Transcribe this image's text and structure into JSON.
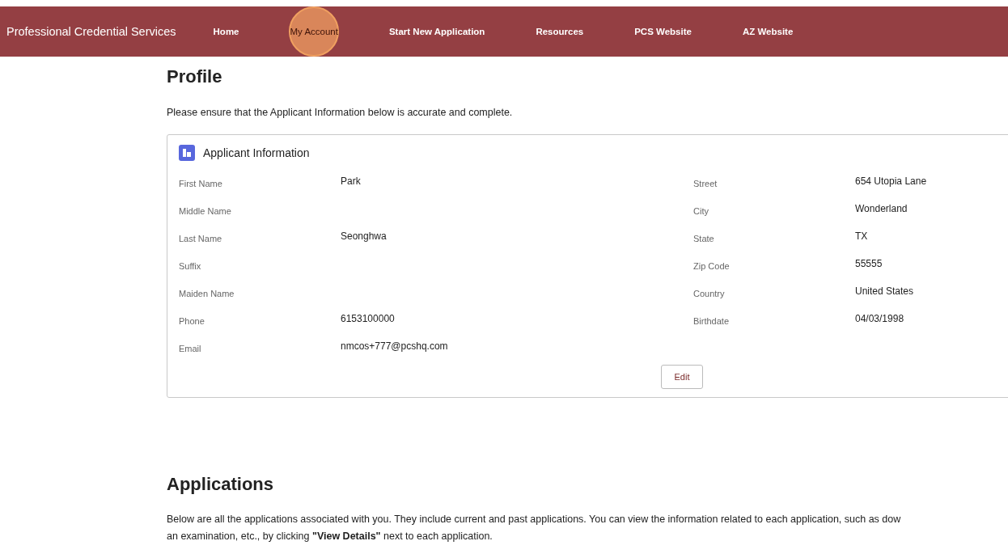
{
  "nav": {
    "brand": "Professional Credential Services",
    "items": [
      {
        "label": "Home",
        "highlighted": false
      },
      {
        "label": "My Account",
        "highlighted": true
      },
      {
        "label": "Start New Application",
        "highlighted": false
      },
      {
        "label": "Resources",
        "highlighted": false
      },
      {
        "label": "PCS Website",
        "highlighted": false
      },
      {
        "label": "AZ Website",
        "highlighted": false
      }
    ]
  },
  "profile": {
    "title": "Profile",
    "intro": "Please ensure that the Applicant Information below is accurate and complete.",
    "card": {
      "title": "Applicant Information",
      "left_fields": [
        {
          "label": "First Name",
          "value": "Park"
        },
        {
          "label": "Middle Name"
        },
        {
          "label": "Last Name",
          "value": "Seonghwa"
        },
        {
          "label": "Suffix"
        },
        {
          "label": "Maiden Name"
        },
        {
          "label": "Phone",
          "value": "6153100000"
        },
        {
          "label": "Email",
          "value": "nmcos+777@pcshq.com"
        }
      ],
      "right_fields": [
        {
          "label": "Street",
          "value": "654 Utopia Lane"
        },
        {
          "label": "City",
          "value": "Wonderland"
        },
        {
          "label": "State",
          "value": "TX"
        },
        {
          "label": "Zip Code",
          "value": "55555"
        },
        {
          "label": "Country",
          "value": "United States"
        },
        {
          "label": "Birthdate",
          "value": "04/03/1998"
        }
      ],
      "edit_button": "Edit"
    }
  },
  "applications": {
    "title": "Applications",
    "description_lines": [
      "Below are all the applications associated with you. They include current and past applications. You can view the information related to each application, such as dow",
      "an examination, etc., by clicking **\"View Details\"** next to each application."
    ]
  }
}
